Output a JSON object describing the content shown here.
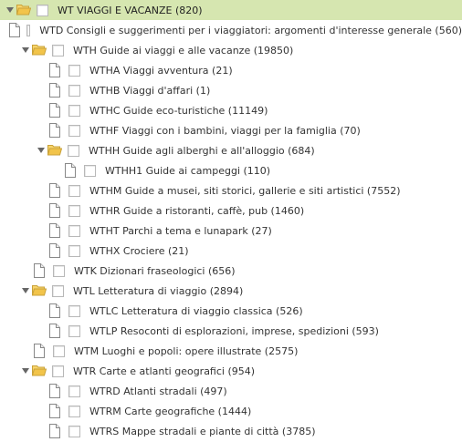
{
  "tree": {
    "rows": [
      {
        "label": "WT VIAGGI E VACANZE (820)",
        "icon": "folder-open-icon",
        "expanded": true,
        "selected": true
      },
      {
        "label": "WTD Consigli e suggerimenti per i viaggiatori: argomenti d'interesse generale (560)",
        "icon": "document-icon"
      },
      {
        "label": "WTH Guide ai viaggi e alle vacanze (19850)",
        "icon": "folder-open-icon",
        "expanded": true
      },
      {
        "label": "WTHA Viaggi avventura (21)",
        "icon": "document-icon"
      },
      {
        "label": "WTHB Viaggi d'affari (1)",
        "icon": "document-icon"
      },
      {
        "label": "WTHC Guide eco-turistiche (11149)",
        "icon": "document-icon"
      },
      {
        "label": "WTHF Viaggi con i bambini, viaggi per la famiglia (70)",
        "icon": "document-icon"
      },
      {
        "label": "WTHH Guide agli alberghi e all'alloggio (684)",
        "icon": "folder-open-icon",
        "expanded": true
      },
      {
        "label": "WTHH1 Guide ai campeggi (110)",
        "icon": "document-icon"
      },
      {
        "label": "WTHM Guide a musei, siti storici, gallerie e siti artistici (7552)",
        "icon": "document-icon"
      },
      {
        "label": "WTHR Guide a ristoranti, caffè, pub (1460)",
        "icon": "document-icon"
      },
      {
        "label": "WTHT Parchi a tema e lunapark (27)",
        "icon": "document-icon"
      },
      {
        "label": "WTHX Crociere (21)",
        "icon": "document-icon"
      },
      {
        "label": "WTK Dizionari fraseologici (656)",
        "icon": "document-icon"
      },
      {
        "label": "WTL Letteratura di viaggio (2894)",
        "icon": "folder-open-icon",
        "expanded": true
      },
      {
        "label": "WTLC Letteratura di viaggio classica (526)",
        "icon": "document-icon"
      },
      {
        "label": "WTLP Resoconti di esplorazioni, imprese, spedizioni (593)",
        "icon": "document-icon"
      },
      {
        "label": "WTM Luoghi e popoli: opere illustrate (2575)",
        "icon": "document-icon"
      },
      {
        "label": "WTR Carte e atlanti geografici (954)",
        "icon": "folder-open-icon",
        "expanded": true
      },
      {
        "label": "WTRD Atlanti stradali (497)",
        "icon": "document-icon"
      },
      {
        "label": "WTRM Carte geografiche (1444)",
        "icon": "document-icon"
      },
      {
        "label": "WTRS Mappe stradali e piante di città (3785)",
        "icon": "document-icon"
      }
    ]
  },
  "colors": {
    "selected_row": "#d6e6b0",
    "folder": "#f0c040",
    "text": "#333333"
  }
}
